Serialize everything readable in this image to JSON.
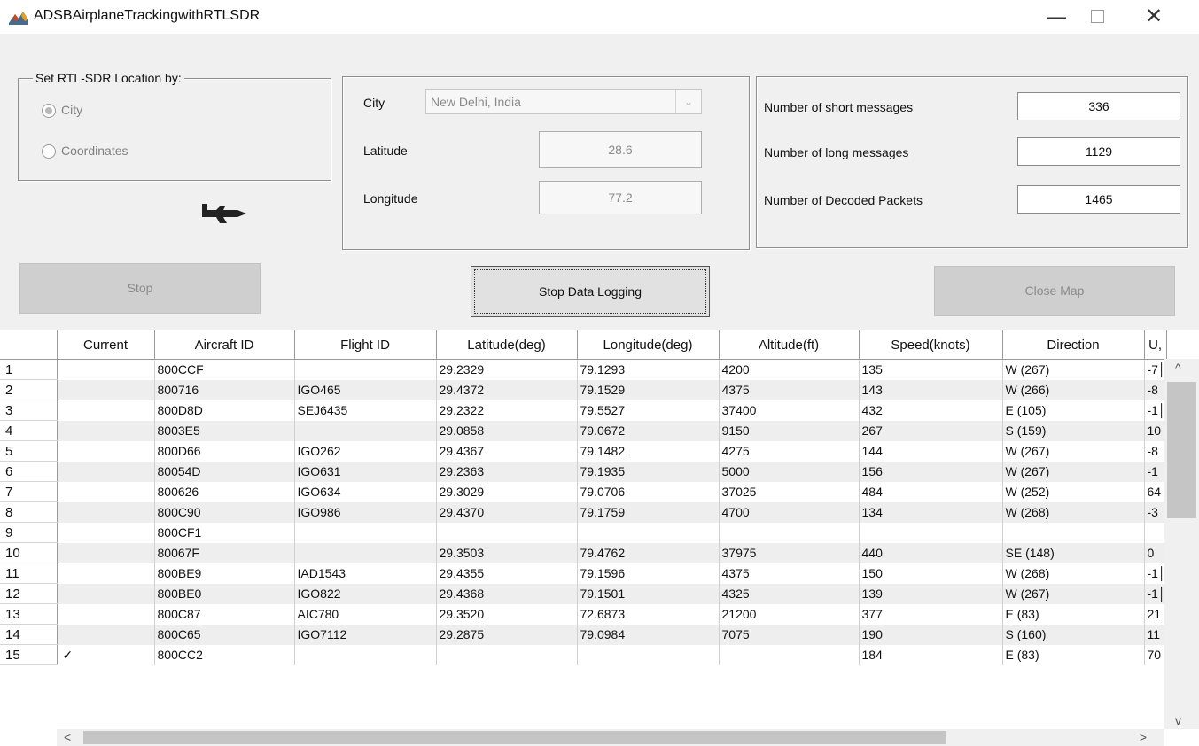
{
  "window": {
    "title": "ADSBAirplaneTrackingwithRTLSDR",
    "minimize": "—",
    "close": "✕"
  },
  "location_panel": {
    "legend": "Set RTL-SDR Location by:",
    "options": [
      {
        "label": "City",
        "selected": true
      },
      {
        "label": "Coordinates",
        "selected": false
      }
    ]
  },
  "coords_panel": {
    "city_label": "City",
    "city_value": "New Delhi, India",
    "latitude_label": "Latitude",
    "latitude_value": "28.6",
    "longitude_label": "Longitude",
    "longitude_value": "77.2"
  },
  "stats_panel": {
    "short_label": "Number of short messages",
    "short_value": "336",
    "long_label": "Number of long messages",
    "long_value": "1129",
    "decoded_label": "Number of Decoded Packets",
    "decoded_value": "1465"
  },
  "buttons": {
    "stop": "Stop",
    "stop_logging": "Stop Data Logging",
    "close_map": "Close Map"
  },
  "table": {
    "columns": [
      "",
      "Current",
      "Aircraft ID",
      "Flight ID",
      "Latitude(deg)",
      "Longitude(deg)",
      "Altitude(ft)",
      "Speed(knots)",
      "Direction",
      "U,"
    ],
    "rows": [
      [
        "1",
        "",
        "800CCF",
        "",
        "29.2329",
        "79.1293",
        "4200",
        "135",
        "W (267)",
        "-7│"
      ],
      [
        "2",
        "",
        "800716",
        "IGO465",
        "29.4372",
        "79.1529",
        "4375",
        "143",
        "W (266)",
        "-8"
      ],
      [
        "3",
        "",
        "800D8D",
        "SEJ6435",
        "29.2322",
        "79.5527",
        "37400",
        "432",
        "E (105)",
        "-1│"
      ],
      [
        "4",
        "",
        "8003E5",
        "",
        "29.0858",
        "79.0672",
        "9150",
        "267",
        "S (159)",
        "10"
      ],
      [
        "5",
        "",
        "800D66",
        "IGO262",
        "29.4367",
        "79.1482",
        "4275",
        "144",
        "W (267)",
        "-8"
      ],
      [
        "6",
        "",
        "80054D",
        "IGO631",
        "29.2363",
        "79.1935",
        "5000",
        "156",
        "W (267)",
        "-1"
      ],
      [
        "7",
        "",
        "800626",
        "IGO634",
        "29.3029",
        "79.0706",
        "37025",
        "484",
        "W (252)",
        "64"
      ],
      [
        "8",
        "",
        "800C90",
        "IGO986",
        "29.4370",
        "79.1759",
        "4700",
        "134",
        "W (268)",
        "-3"
      ],
      [
        "9",
        "",
        "800CF1",
        "",
        "",
        "",
        "",
        "",
        "",
        ""
      ],
      [
        "10",
        "",
        "80067F",
        "",
        "29.3503",
        "79.4762",
        "37975",
        "440",
        "SE (148)",
        "0"
      ],
      [
        "11",
        "",
        "800BE9",
        "IAD1543",
        "29.4355",
        "79.1596",
        "4375",
        "150",
        "W (268)",
        "-1│"
      ],
      [
        "12",
        "",
        "800BE0",
        "IGO822",
        "29.4368",
        "79.1501",
        "4325",
        "139",
        "W (267)",
        "-1│"
      ],
      [
        "13",
        "",
        "800C87",
        "AIC780",
        "29.3520",
        "72.6873",
        "21200",
        "377",
        "E (83)",
        "21"
      ],
      [
        "14",
        "",
        "800C65",
        "IGO7112",
        "29.2875",
        "79.0984",
        "7075",
        "190",
        "S (160)",
        "11"
      ],
      [
        "15",
        "✓",
        "800CC2",
        "",
        "",
        "",
        "",
        "184",
        "E (83)",
        "70"
      ]
    ]
  },
  "scroll": {
    "up": "^",
    "down": "v",
    "left": "<",
    "right": ">"
  },
  "icons": [
    "app-icon",
    "airplane-icon",
    "chevron-down-icon"
  ]
}
